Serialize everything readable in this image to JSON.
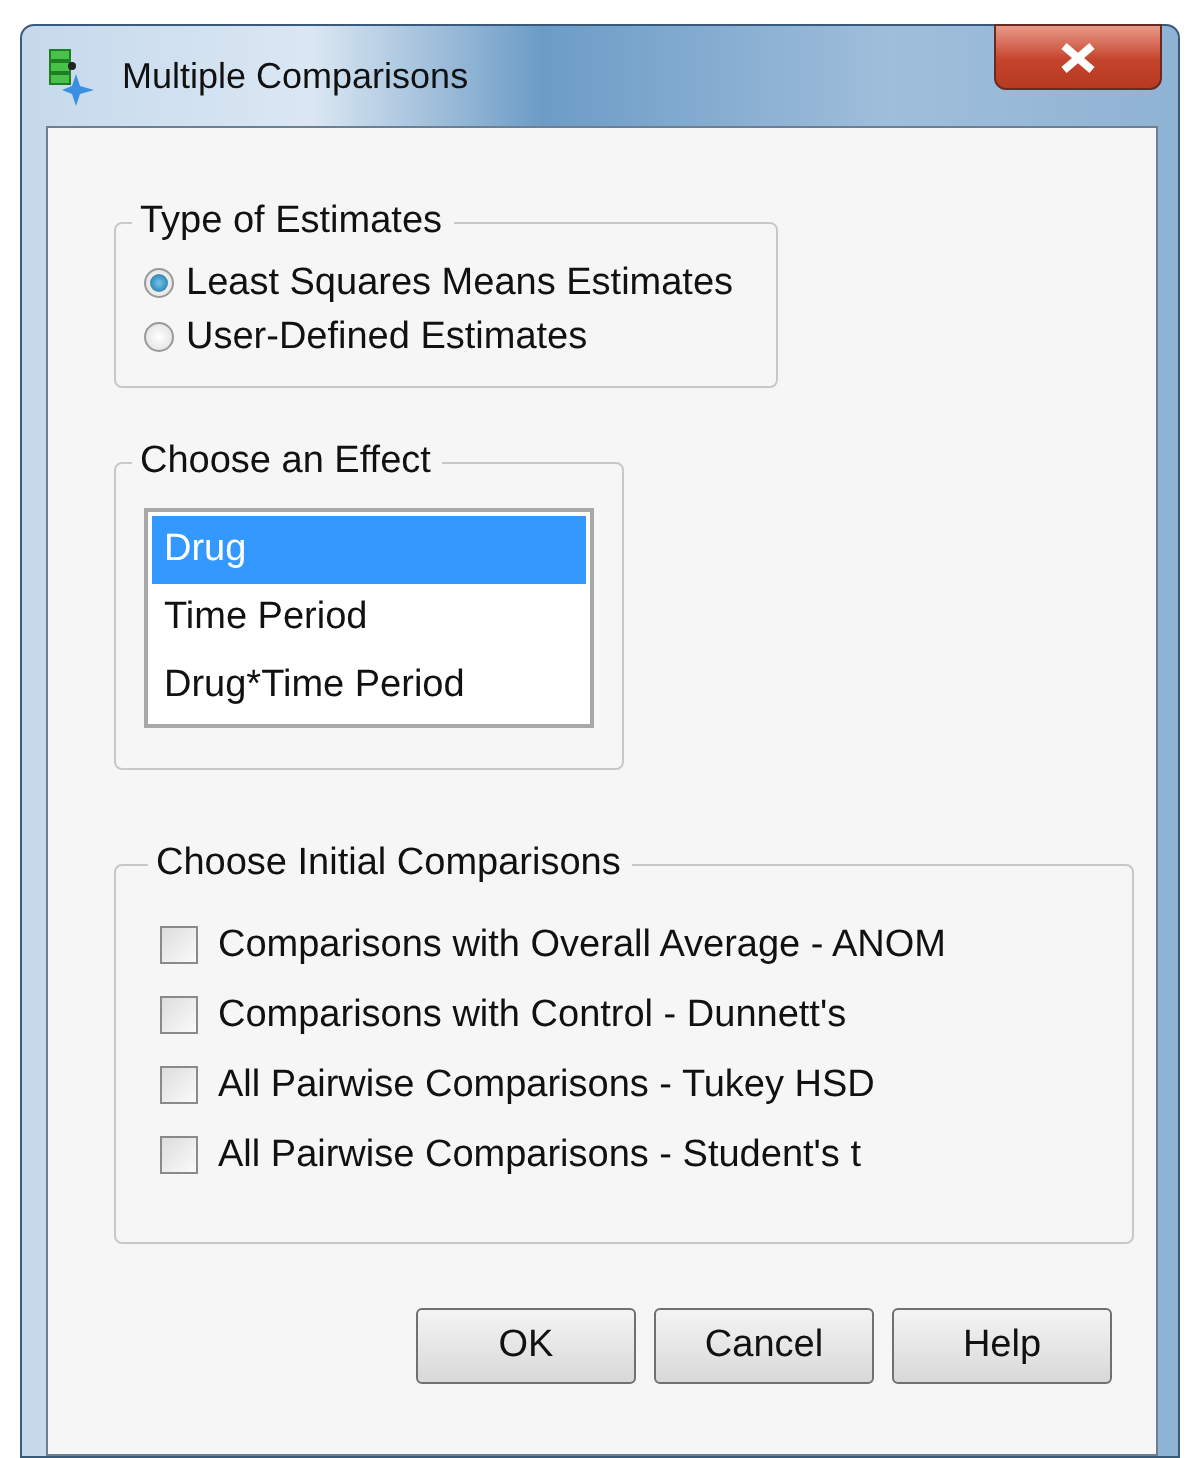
{
  "window": {
    "title": "Multiple Comparisons"
  },
  "type_of_estimates": {
    "legend": "Type of Estimates",
    "options": [
      {
        "label": "Least Squares Means Estimates",
        "selected": true
      },
      {
        "label": "User-Defined Estimates",
        "selected": false
      }
    ]
  },
  "choose_effect": {
    "legend": "Choose an Effect",
    "items": [
      {
        "label": "Drug",
        "selected": true
      },
      {
        "label": "Time Period",
        "selected": false
      },
      {
        "label": "Drug*Time Period",
        "selected": false
      }
    ]
  },
  "initial_comparisons": {
    "legend": "Choose Initial Comparisons",
    "options": [
      {
        "label": "Comparisons with Overall Average - ANOM",
        "checked": false
      },
      {
        "label": "Comparisons with Control - Dunnett's",
        "checked": false
      },
      {
        "label": "All Pairwise Comparisons - Tukey HSD",
        "checked": false
      },
      {
        "label": "All Pairwise Comparisons - Student's t",
        "checked": false
      }
    ]
  },
  "buttons": [
    "OK",
    "Cancel",
    "Help"
  ]
}
